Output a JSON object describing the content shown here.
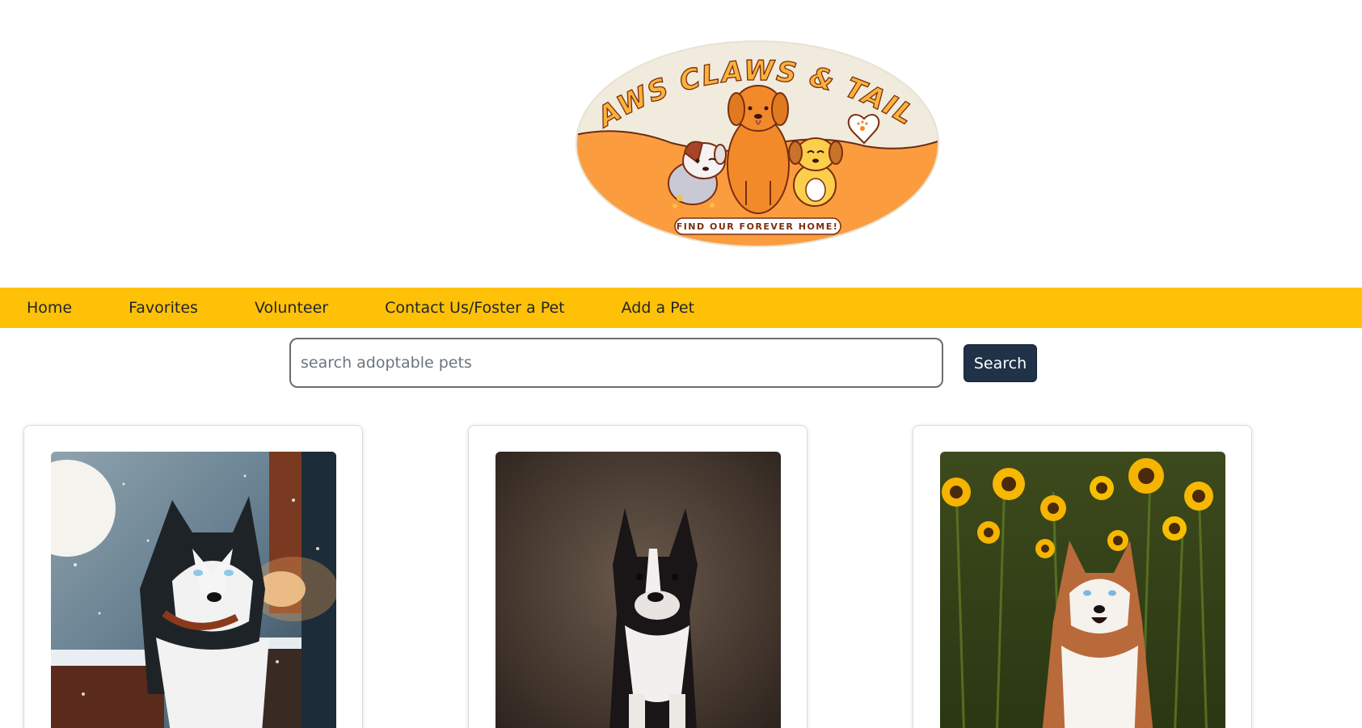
{
  "brand": {
    "logo_title": "PAWS CLAWS & TAILS",
    "logo_tagline": "FIND OUR FOREVER HOME!"
  },
  "nav": {
    "items": [
      {
        "label": "Home"
      },
      {
        "label": "Favorites"
      },
      {
        "label": "Volunteer"
      },
      {
        "label": "Contact Us/Foster a Pet"
      },
      {
        "label": "Add a Pet"
      }
    ]
  },
  "search": {
    "placeholder": "search adoptable pets",
    "value": "",
    "button_label": "Search"
  },
  "pets": [
    {
      "photo": "husky-in-snow"
    },
    {
      "photo": "boston-terrier"
    },
    {
      "photo": "husky-in-sunflowers"
    }
  ],
  "colors": {
    "navbar": "#ffc107",
    "search_button": "#1f3247",
    "logo_orange": "#fb9c3f",
    "logo_cream": "#f1ebdd"
  }
}
